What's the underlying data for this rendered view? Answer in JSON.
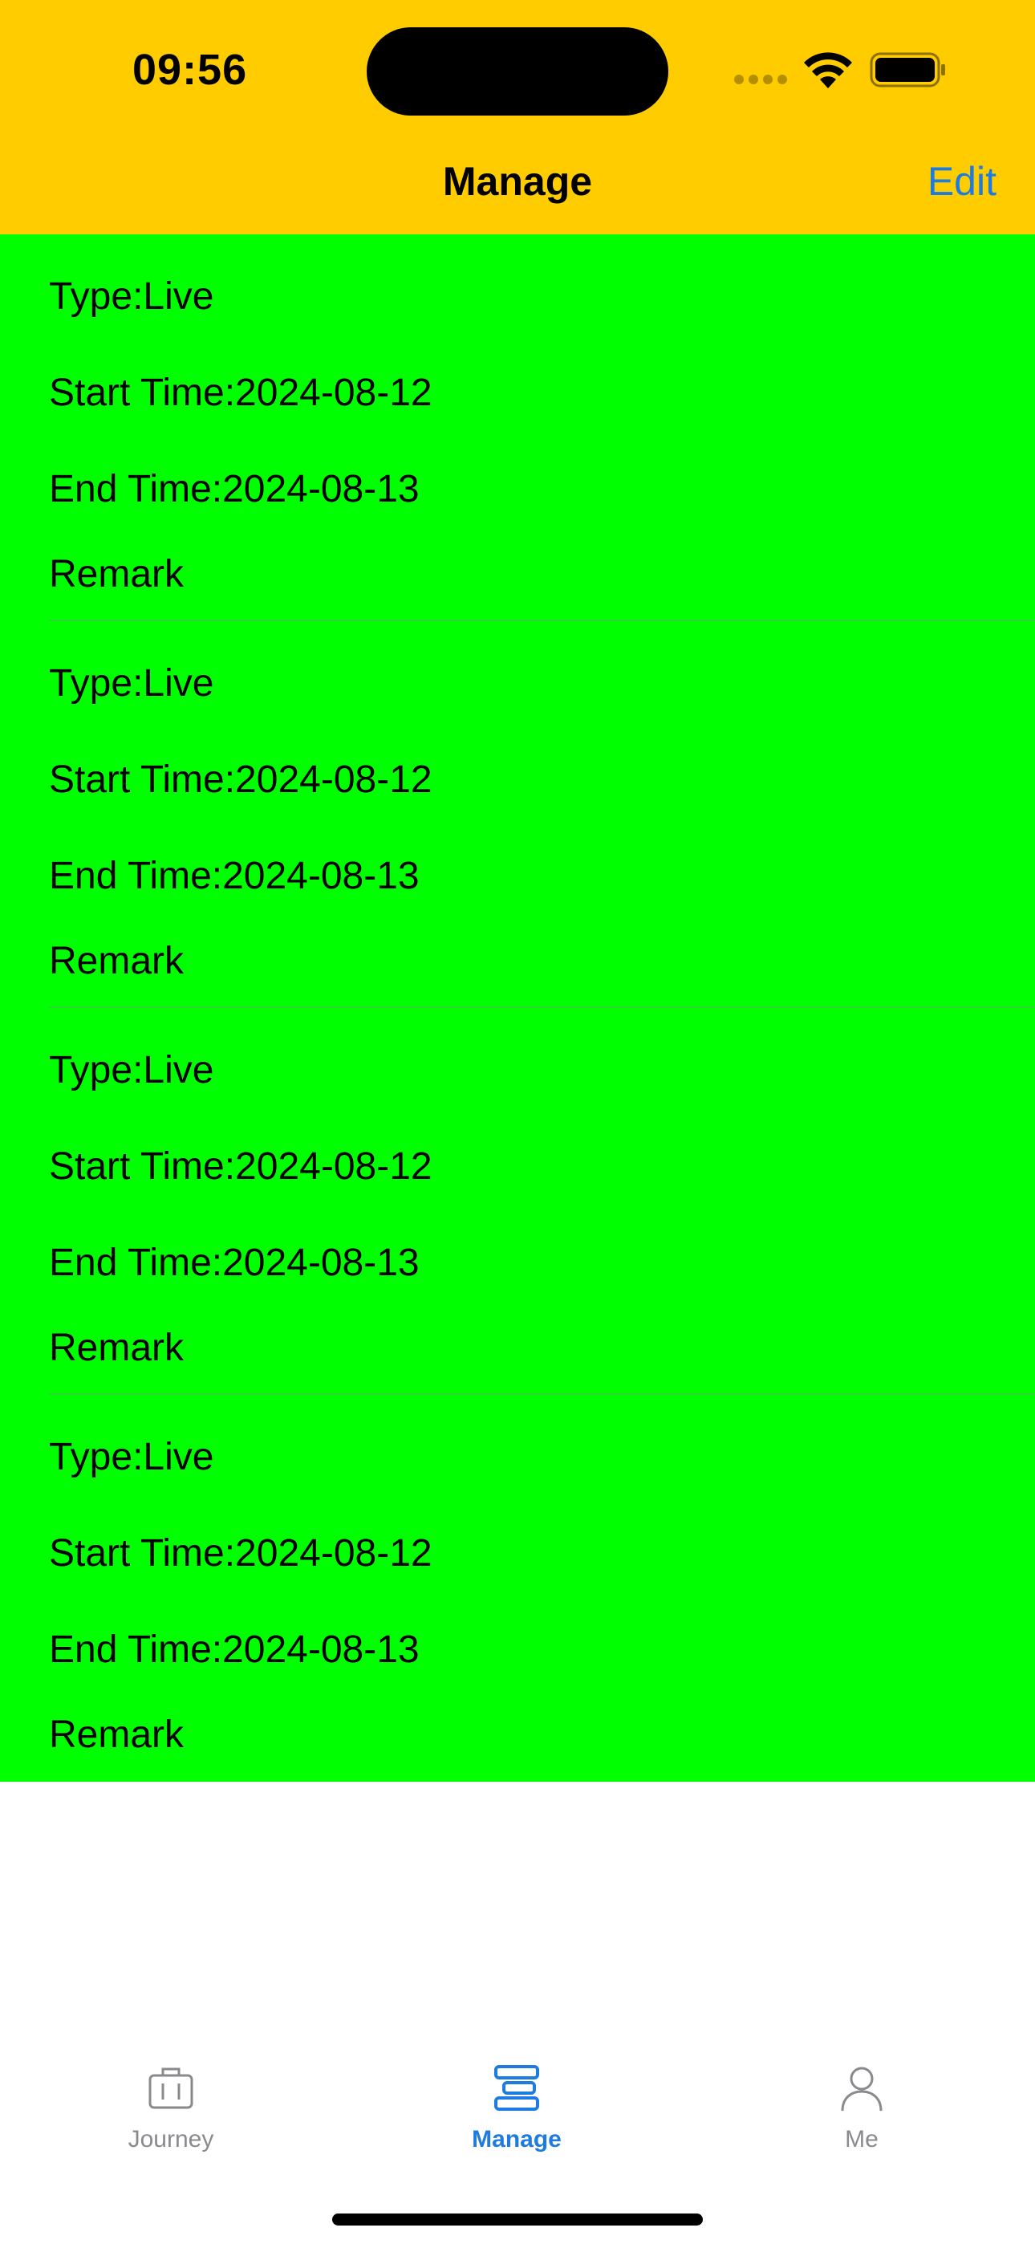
{
  "status_bar": {
    "time": "09:56"
  },
  "nav": {
    "title": "Manage",
    "edit_label": "Edit"
  },
  "colors": {
    "header_bg": "#FFCC00",
    "list_bg": "#00FF00",
    "accent": "#1E7BE0",
    "inactive": "#8A8A8E"
  },
  "items": [
    {
      "type": "Type:Live",
      "start": "Start Time:2024-08-12",
      "end": "End Time:2024-08-13",
      "remark": "Remark"
    },
    {
      "type": "Type:Live",
      "start": "Start Time:2024-08-12",
      "end": "End Time:2024-08-13",
      "remark": "Remark"
    },
    {
      "type": "Type:Live",
      "start": "Start Time:2024-08-12",
      "end": "End Time:2024-08-13",
      "remark": "Remark"
    },
    {
      "type": "Type:Live",
      "start": "Start Time:2024-08-12",
      "end": "End Time:2024-08-13",
      "remark": "Remark"
    }
  ],
  "tabbar": {
    "tabs": [
      {
        "label": "Journey",
        "icon": "suitcase-icon",
        "active": false
      },
      {
        "label": "Manage",
        "icon": "manage-icon",
        "active": true
      },
      {
        "label": "Me",
        "icon": "person-icon",
        "active": false
      }
    ]
  }
}
